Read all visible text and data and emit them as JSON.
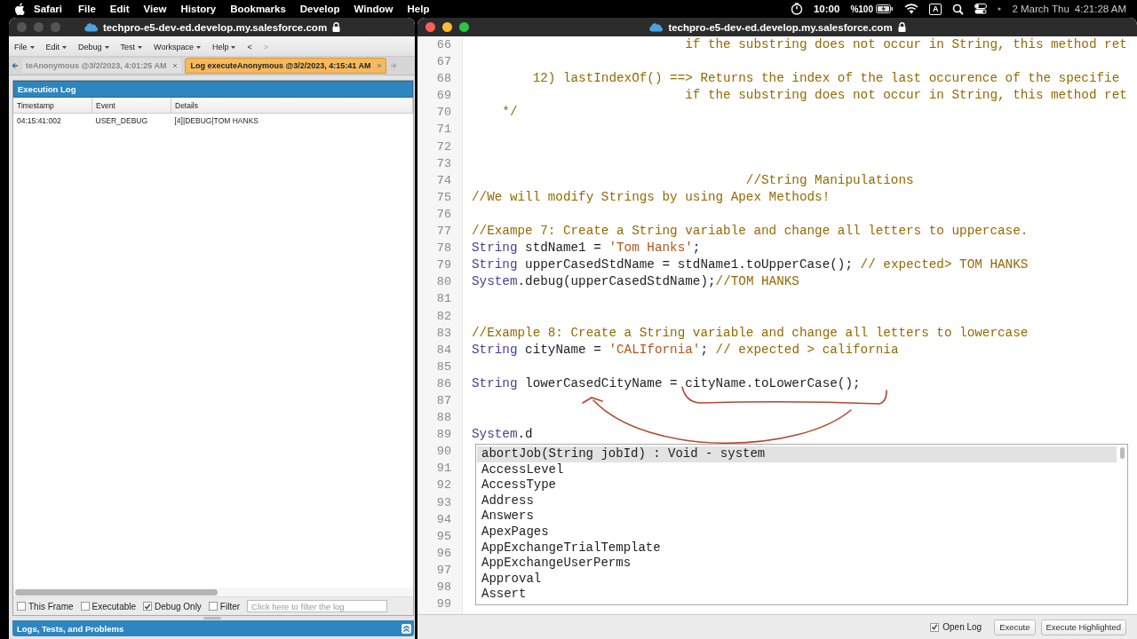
{
  "menubar": {
    "app": "Safari",
    "menus": [
      "File",
      "Edit",
      "View",
      "History",
      "Bookmarks",
      "Develop",
      "Window",
      "Help"
    ],
    "status": {
      "timer": "10:00",
      "battery": "%100",
      "input_source": "A",
      "date": "2 March Thu",
      "time": "4:21:28 AM"
    }
  },
  "log_window": {
    "url": "techpro-e5-dev-ed.develop.my.salesforce.com",
    "menu": [
      {
        "label": "File",
        "dropdown": true,
        "disabled": false
      },
      {
        "label": "Edit",
        "dropdown": true,
        "disabled": false
      },
      {
        "label": "Debug",
        "dropdown": true,
        "disabled": false
      },
      {
        "label": "Test",
        "dropdown": true,
        "disabled": false
      },
      {
        "label": "Workspace",
        "dropdown": true,
        "disabled": false
      },
      {
        "label": "Help",
        "dropdown": true,
        "disabled": false
      },
      {
        "label": "<",
        "dropdown": false,
        "disabled": false
      },
      {
        "label": ">",
        "dropdown": false,
        "disabled": true
      }
    ],
    "tabs": [
      {
        "label": "teAnonymous @3/2/2023, 4:01:25 AM",
        "selected": false
      },
      {
        "label": "Log executeAnonymous @3/2/2023, 4:15:41 AM",
        "selected": true
      }
    ],
    "execution_log": {
      "title": "Execution Log",
      "columns": [
        "Timestamp",
        "Event",
        "Details"
      ],
      "rows": [
        [
          "04:15:41:002",
          "USER_DEBUG",
          "[4]|DEBUG|TOM HANKS"
        ]
      ]
    },
    "filters": [
      {
        "label": "This Frame",
        "checked": false
      },
      {
        "label": "Executable",
        "checked": false
      },
      {
        "label": "Debug Only",
        "checked": true
      },
      {
        "label": "Filter",
        "checked": false
      }
    ],
    "filter_field": {
      "placeholder": "Click here to filter the log"
    },
    "bottom_panel": {
      "title": "Logs, Tests, and Problems"
    }
  },
  "editor_window": {
    "url": "techpro-e5-dev-ed.develop.my.salesforce.com",
    "lines": [
      {
        "number": "66",
        "segments": [
          {
            "kind": "comment",
            "text": "                            if the substring does not occur in String, this method ret"
          }
        ]
      },
      {
        "number": "67"
      },
      {
        "number": "68",
        "segments": [
          {
            "kind": "comment",
            "text": "        12) lastIndexOf() ==> Returns the index of the last occurence of the specifie"
          }
        ]
      },
      {
        "number": "69",
        "segments": [
          {
            "kind": "comment",
            "text": "                            if the substring does not occur in String, this method ret"
          }
        ]
      },
      {
        "number": "70",
        "segments": [
          {
            "kind": "comment",
            "text": "    */"
          }
        ]
      },
      {
        "number": "71"
      },
      {
        "number": "72"
      },
      {
        "number": "73"
      },
      {
        "number": "74",
        "segments": [
          {
            "kind": "comment",
            "text": "                                    //String Manipulations"
          }
        ]
      },
      {
        "number": "75",
        "segments": [
          {
            "kind": "comment",
            "text": "//We will modify Strings by using Apex Methods!"
          }
        ]
      },
      {
        "number": "76"
      },
      {
        "number": "77",
        "segments": [
          {
            "kind": "comment",
            "text": "//Exampe 7: Create a String variable and change all letters to uppercase."
          }
        ]
      },
      {
        "number": "78",
        "segments": [
          {
            "kind": "keyword",
            "text": "String"
          },
          {
            "kind": "plain",
            "text": " stdName1 = "
          },
          {
            "kind": "string",
            "text": "'Tom Hanks'"
          },
          {
            "kind": "plain",
            "text": ";"
          }
        ]
      },
      {
        "number": "79",
        "segments": [
          {
            "kind": "keyword",
            "text": "String"
          },
          {
            "kind": "plain",
            "text": " upperCasedStdName = stdName1.toUpperCase(); "
          },
          {
            "kind": "comment",
            "text": "// expected> TOM HANKS"
          }
        ]
      },
      {
        "number": "80",
        "segments": [
          {
            "kind": "keyword",
            "text": "System"
          },
          {
            "kind": "plain",
            "text": ".debug(upperCasedStdName);"
          },
          {
            "kind": "comment",
            "text": "//TOM HANKS"
          }
        ]
      },
      {
        "number": "81"
      },
      {
        "number": "82"
      },
      {
        "number": "83",
        "segments": [
          {
            "kind": "comment",
            "text": "//Example 8: Create a String variable and change all letters to lowercase"
          }
        ]
      },
      {
        "number": "84",
        "segments": [
          {
            "kind": "keyword",
            "text": "String"
          },
          {
            "kind": "plain",
            "text": " cityName = "
          },
          {
            "kind": "string",
            "text": "'CALIfornia'"
          },
          {
            "kind": "plain",
            "text": "; "
          },
          {
            "kind": "comment",
            "text": "// expected > california"
          }
        ]
      },
      {
        "number": "85"
      },
      {
        "number": "86",
        "segments": [
          {
            "kind": "keyword",
            "text": "String"
          },
          {
            "kind": "plain",
            "text": " lowerCasedCityName = cityName.toLowerCase();"
          }
        ]
      },
      {
        "number": "87"
      },
      {
        "number": "88"
      },
      {
        "number": "89",
        "segments": [
          {
            "kind": "keyword",
            "text": "System"
          },
          {
            "kind": "plain",
            "text": ".d"
          }
        ]
      },
      {
        "number": "90"
      },
      {
        "number": "91"
      },
      {
        "number": "92"
      },
      {
        "number": "93"
      },
      {
        "number": "94"
      },
      {
        "number": "95"
      },
      {
        "number": "96"
      },
      {
        "number": "97"
      },
      {
        "number": "98"
      },
      {
        "number": "99"
      }
    ],
    "autocomplete": [
      {
        "label": "abortJob(String jobId) : Void - system",
        "selected": true
      },
      {
        "label": "AccessLevel",
        "selected": false
      },
      {
        "label": "AccessType",
        "selected": false
      },
      {
        "label": "Address",
        "selected": false
      },
      {
        "label": "Answers",
        "selected": false
      },
      {
        "label": "ApexPages",
        "selected": false
      },
      {
        "label": "AppExchangeTrialTemplate",
        "selected": false
      },
      {
        "label": "AppExchangeUserPerms",
        "selected": false
      },
      {
        "label": "Approval",
        "selected": false
      },
      {
        "label": "Assert",
        "selected": false
      }
    ],
    "open_log": {
      "label": "Open Log",
      "checked": true
    },
    "buttons": [
      "Execute",
      "Execute Highlighted"
    ]
  }
}
